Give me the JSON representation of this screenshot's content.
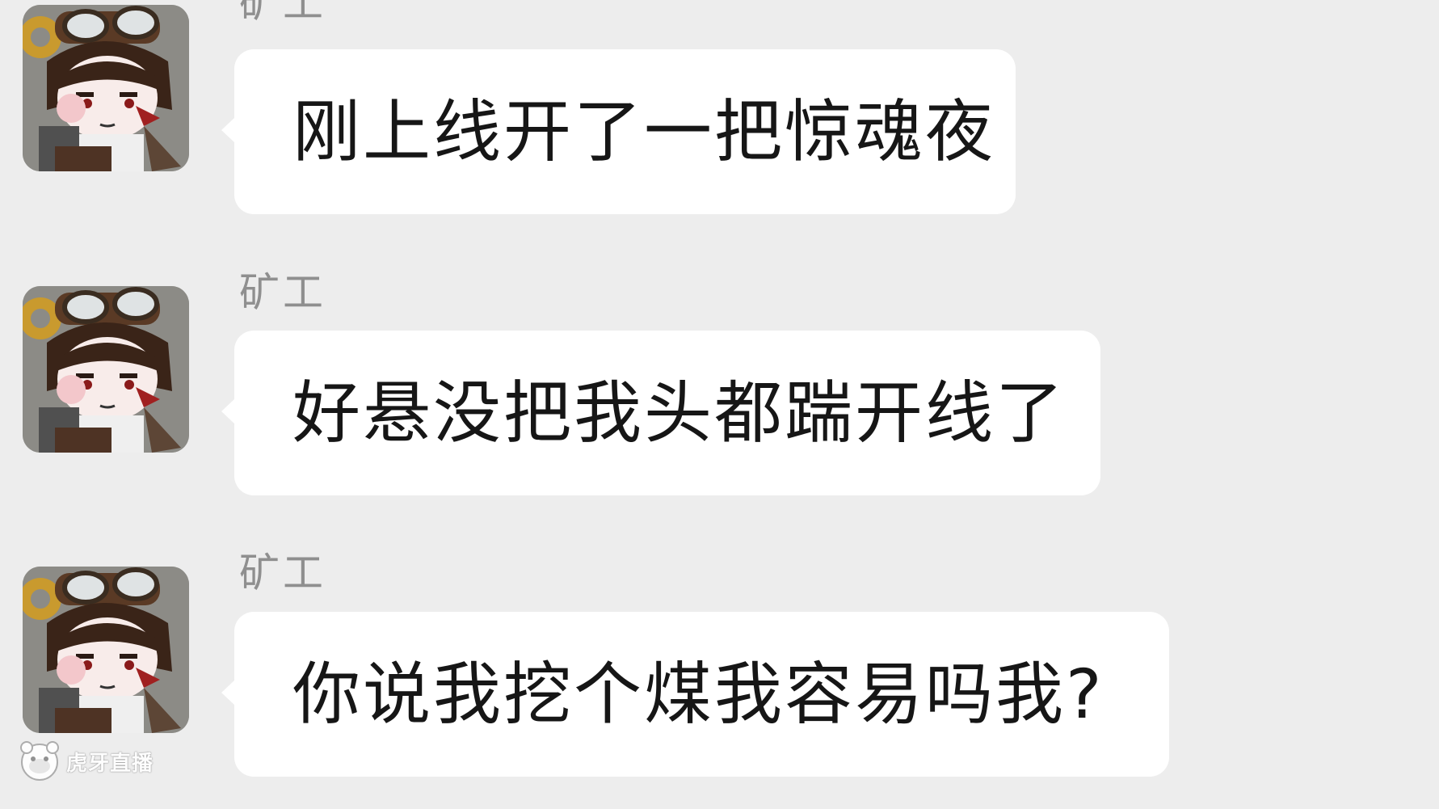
{
  "messages": [
    {
      "sender": "矿工",
      "text": "刚上线开了一把惊魂夜"
    },
    {
      "sender": "矿工",
      "text": "好悬没把我头都踹开线了"
    },
    {
      "sender": "矿工",
      "text": "你说我挖个煤我容易吗我?"
    }
  ],
  "watermark": {
    "label": "虎牙直播"
  },
  "colors": {
    "background": "#ededed",
    "bubble": "#ffffff",
    "sender_text": "#8f8f8f",
    "message_text": "#161616"
  }
}
